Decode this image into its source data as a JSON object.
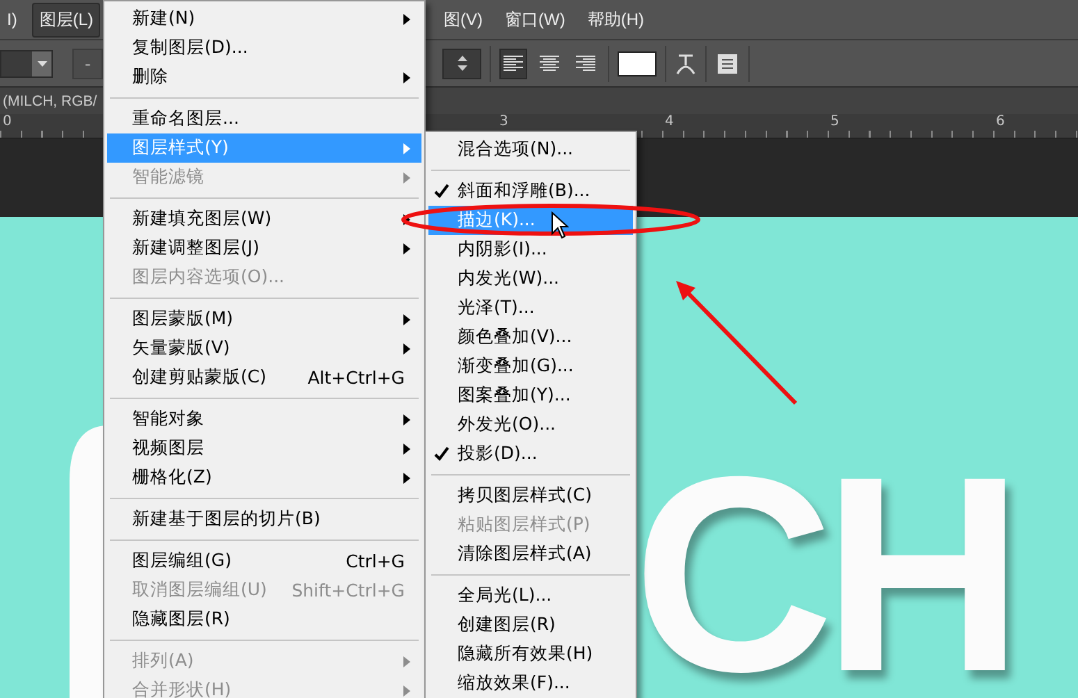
{
  "menubar": [
    {
      "label": "I)",
      "selected": false
    },
    {
      "label": "图层(L)",
      "selected": true
    },
    {
      "label": "图(V)",
      "selected": false
    },
    {
      "label": "窗口(W)",
      "selected": false
    },
    {
      "label": "帮助(H)",
      "selected": false
    }
  ],
  "options_bar": {
    "size_button": "-",
    "align": [
      {
        "selected": true
      },
      {
        "selected": false
      },
      {
        "selected": false
      }
    ]
  },
  "document_tab": {
    "title": "(MILCH, RGB/"
  },
  "ruler": {
    "labels": [
      "0",
      "3",
      "4",
      "5",
      "6"
    ]
  },
  "canvas": {
    "letters": "CH"
  },
  "layer_menu": {
    "items": [
      {
        "kind": "item",
        "label": "新建(N)",
        "submenu": true,
        "disabled": false,
        "selected": false
      },
      {
        "kind": "item",
        "label": "复制图层(D)...",
        "submenu": false,
        "disabled": false,
        "selected": false
      },
      {
        "kind": "item",
        "label": "删除",
        "submenu": true,
        "disabled": false,
        "selected": false
      },
      {
        "kind": "separator"
      },
      {
        "kind": "item",
        "label": "重命名图层...",
        "submenu": false,
        "disabled": false,
        "selected": false
      },
      {
        "kind": "item",
        "label": "图层样式(Y)",
        "submenu": true,
        "disabled": false,
        "selected": true
      },
      {
        "kind": "item",
        "label": "智能滤镜",
        "submenu": true,
        "disabled": true,
        "selected": false
      },
      {
        "kind": "separator"
      },
      {
        "kind": "item",
        "label": "新建填充图层(W)",
        "submenu": true,
        "disabled": false,
        "selected": false
      },
      {
        "kind": "item",
        "label": "新建调整图层(J)",
        "submenu": true,
        "disabled": false,
        "selected": false
      },
      {
        "kind": "item",
        "label": "图层内容选项(O)...",
        "submenu": false,
        "disabled": true,
        "selected": false
      },
      {
        "kind": "separator"
      },
      {
        "kind": "item",
        "label": "图层蒙版(M)",
        "submenu": true,
        "disabled": false,
        "selected": false
      },
      {
        "kind": "item",
        "label": "矢量蒙版(V)",
        "submenu": true,
        "disabled": false,
        "selected": false
      },
      {
        "kind": "item",
        "label": "创建剪贴蒙版(C)",
        "shortcut": "Alt+Ctrl+G",
        "submenu": false,
        "disabled": false,
        "selected": false
      },
      {
        "kind": "separator"
      },
      {
        "kind": "item",
        "label": "智能对象",
        "submenu": true,
        "disabled": false,
        "selected": false
      },
      {
        "kind": "item",
        "label": "视频图层",
        "submenu": true,
        "disabled": false,
        "selected": false
      },
      {
        "kind": "item",
        "label": "栅格化(Z)",
        "submenu": true,
        "disabled": false,
        "selected": false
      },
      {
        "kind": "separator"
      },
      {
        "kind": "item",
        "label": "新建基于图层的切片(B)",
        "submenu": false,
        "disabled": false,
        "selected": false
      },
      {
        "kind": "separator"
      },
      {
        "kind": "item",
        "label": "图层编组(G)",
        "shortcut": "Ctrl+G",
        "submenu": false,
        "disabled": false,
        "selected": false
      },
      {
        "kind": "item",
        "label": "取消图层编组(U)",
        "shortcut": "Shift+Ctrl+G",
        "submenu": false,
        "disabled": true,
        "selected": false
      },
      {
        "kind": "item",
        "label": "隐藏图层(R)",
        "submenu": false,
        "disabled": false,
        "selected": false
      },
      {
        "kind": "separator"
      },
      {
        "kind": "item",
        "label": "排列(A)",
        "submenu": true,
        "disabled": true,
        "selected": false
      },
      {
        "kind": "item",
        "label": "合并形状(H)",
        "submenu": true,
        "disabled": true,
        "selected": false
      }
    ]
  },
  "layer_style_submenu": {
    "items": [
      {
        "kind": "item",
        "label": "混合选项(N)...",
        "checked": false,
        "disabled": false,
        "selected": false
      },
      {
        "kind": "separator"
      },
      {
        "kind": "item",
        "label": "斜面和浮雕(B)...",
        "checked": true,
        "disabled": false,
        "selected": false
      },
      {
        "kind": "item",
        "label": "描边(K)...",
        "checked": false,
        "disabled": false,
        "selected": true
      },
      {
        "kind": "item",
        "label": "内阴影(I)...",
        "checked": false,
        "disabled": false,
        "selected": false
      },
      {
        "kind": "item",
        "label": "内发光(W)...",
        "checked": false,
        "disabled": false,
        "selected": false
      },
      {
        "kind": "item",
        "label": "光泽(T)...",
        "checked": false,
        "disabled": false,
        "selected": false
      },
      {
        "kind": "item",
        "label": "颜色叠加(V)...",
        "checked": false,
        "disabled": false,
        "selected": false
      },
      {
        "kind": "item",
        "label": "渐变叠加(G)...",
        "checked": false,
        "disabled": false,
        "selected": false
      },
      {
        "kind": "item",
        "label": "图案叠加(Y)...",
        "checked": false,
        "disabled": false,
        "selected": false
      },
      {
        "kind": "item",
        "label": "外发光(O)...",
        "checked": false,
        "disabled": false,
        "selected": false
      },
      {
        "kind": "item",
        "label": "投影(D)...",
        "checked": true,
        "disabled": false,
        "selected": false
      },
      {
        "kind": "separator"
      },
      {
        "kind": "item",
        "label": "拷贝图层样式(C)",
        "checked": false,
        "disabled": false,
        "selected": false
      },
      {
        "kind": "item",
        "label": "粘贴图层样式(P)",
        "checked": false,
        "disabled": true,
        "selected": false
      },
      {
        "kind": "item",
        "label": "清除图层样式(A)",
        "checked": false,
        "disabled": false,
        "selected": false
      },
      {
        "kind": "separator"
      },
      {
        "kind": "item",
        "label": "全局光(L)...",
        "checked": false,
        "disabled": false,
        "selected": false
      },
      {
        "kind": "item",
        "label": "创建图层(R)",
        "checked": false,
        "disabled": false,
        "selected": false
      },
      {
        "kind": "item",
        "label": "隐藏所有效果(H)",
        "checked": false,
        "disabled": false,
        "selected": false
      },
      {
        "kind": "item",
        "label": "缩放效果(F)...",
        "checked": false,
        "disabled": false,
        "selected": false
      }
    ]
  }
}
